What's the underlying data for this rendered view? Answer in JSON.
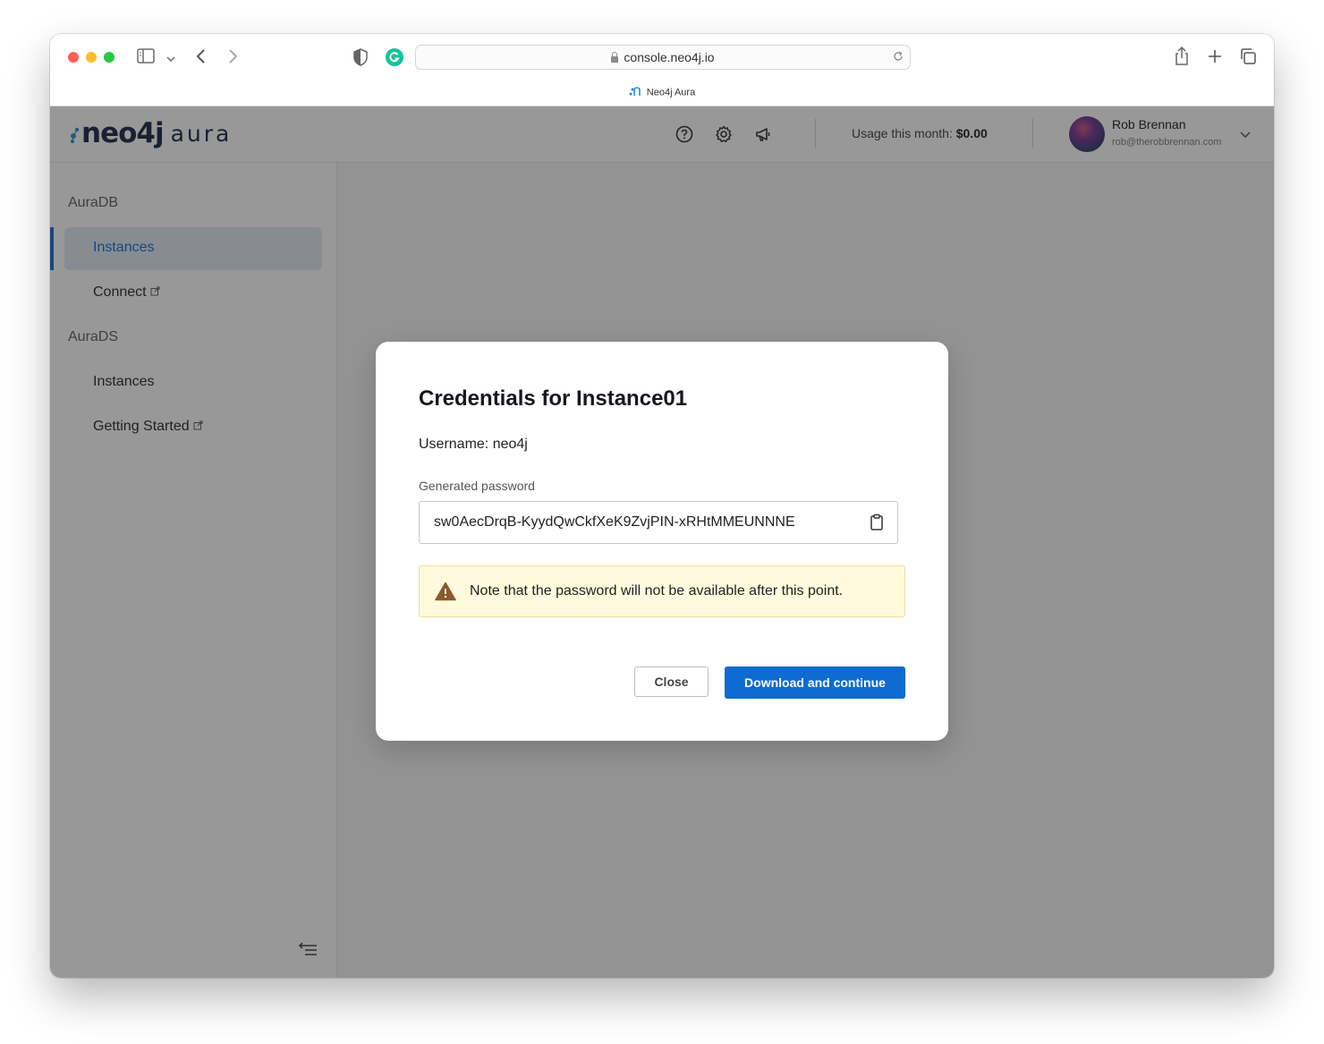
{
  "browser": {
    "url": "console.neo4j.io",
    "tab_title": "Neo4j Aura"
  },
  "header": {
    "logo_primary": "neo4j",
    "logo_secondary": "aura",
    "usage_label": "Usage this month:",
    "usage_value": "$0.00",
    "user_name": "Rob Brennan",
    "user_email": "rob@therobbrennan.com",
    "icons": [
      "help-icon",
      "settings-icon",
      "megaphone-icon"
    ]
  },
  "sidebar": {
    "sections": [
      {
        "label": "AuraDB",
        "items": [
          {
            "label": "Instances",
            "active": true
          },
          {
            "label": "Connect",
            "external": true
          }
        ]
      },
      {
        "label": "AuraDS",
        "items": [
          {
            "label": "Instances",
            "active": false
          },
          {
            "label": "Getting Started",
            "external": true
          }
        ]
      }
    ]
  },
  "modal": {
    "title": "Credentials for Instance01",
    "username": "Username: neo4j",
    "password_label": "Generated password",
    "password_value": "sw0AecDrqB-KyydQwCkfXeK9ZvjPIN-xRHtMMEUNNNE",
    "warning": "Note that the password will not be available after this point.",
    "close_label": "Close",
    "primary_label": "Download and continue"
  },
  "colors": {
    "primary": "#0d6bd1",
    "nav_active_bg": "#dfe9f6",
    "warning_bg": "#fffade",
    "warning_icon": "#8a5a2a"
  }
}
